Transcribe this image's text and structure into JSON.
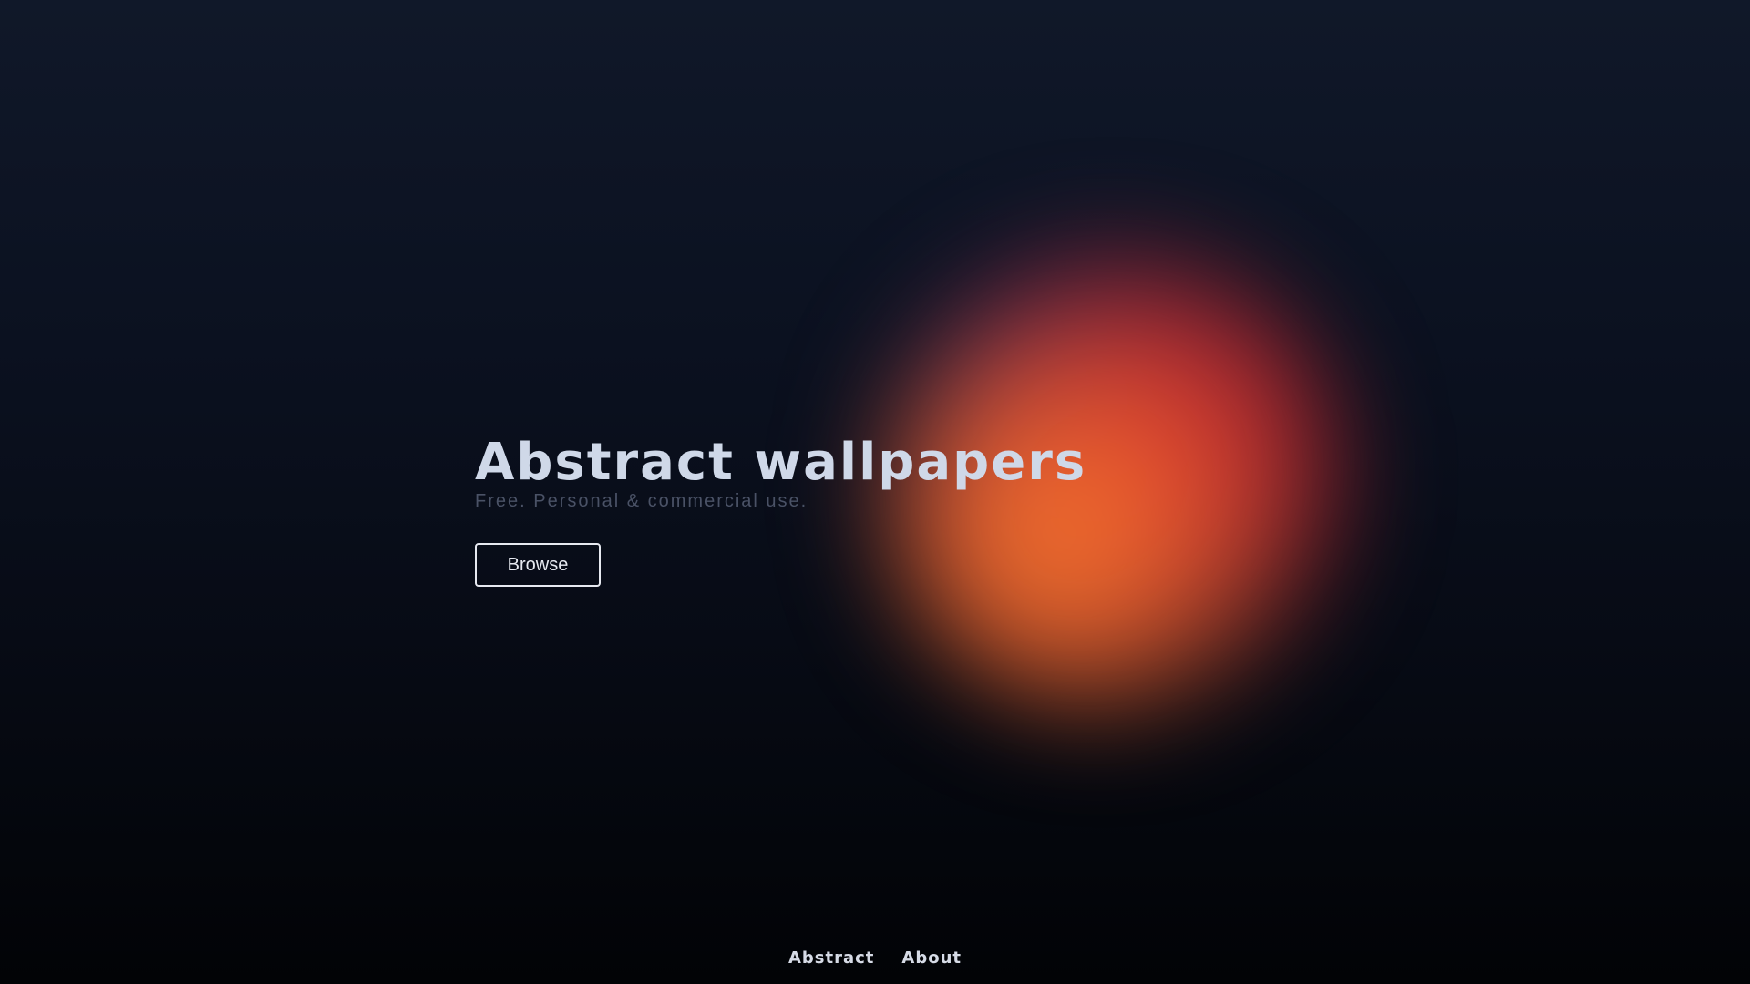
{
  "hero": {
    "title": "Abstract wallpapers",
    "subtitle": "Free. Personal & commercial use.",
    "browse_label": "Browse"
  },
  "footer": {
    "links": [
      {
        "label": "Abstract"
      },
      {
        "label": "About"
      }
    ]
  },
  "colors": {
    "background_top": "#101829",
    "background_bottom": "#020306",
    "title": "#cfd8e8",
    "subtitle": "#4a5266",
    "blob_orange": "#f87a2c",
    "blob_red": "#d62c30"
  }
}
